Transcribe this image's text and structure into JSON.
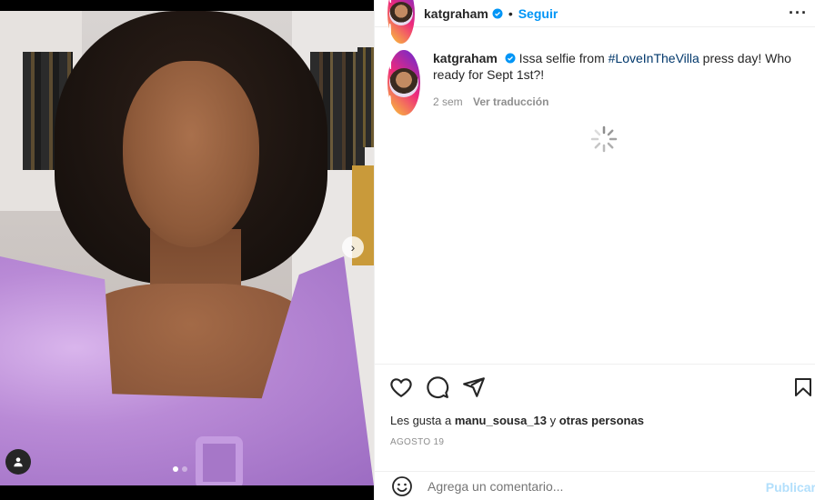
{
  "post": {
    "username": "katgraham",
    "separator": "•",
    "follow_label": "Seguir",
    "more_label": "···",
    "caption_text": "Issa selfie from ",
    "caption_hashtag": "#LoveInTheVilla",
    "caption_rest": " press day! Who ready for Sept 1st?!",
    "time_ago": "2 sem",
    "translate_label": "Ver traducción",
    "likes_prefix": "Les gusta a ",
    "likes_user": "manu_sousa_13",
    "likes_middle": " y ",
    "likes_others": "otras personas",
    "date": "AGOSTO 19",
    "comment_placeholder": "Agrega un comentario...",
    "publish_label": "Publicar"
  },
  "icons": {
    "verified": "verified-badge-icon",
    "like": "heart-icon",
    "comment": "comment-icon",
    "share": "share-icon",
    "save": "bookmark-icon",
    "emoji": "emoji-icon",
    "tag": "user-tag-icon",
    "next": "chevron-right-icon"
  },
  "colors": {
    "link": "#0095f6",
    "hashtag": "#00376b",
    "muted": "#8e8e8e",
    "publish_disabled": "#b2dffc"
  }
}
